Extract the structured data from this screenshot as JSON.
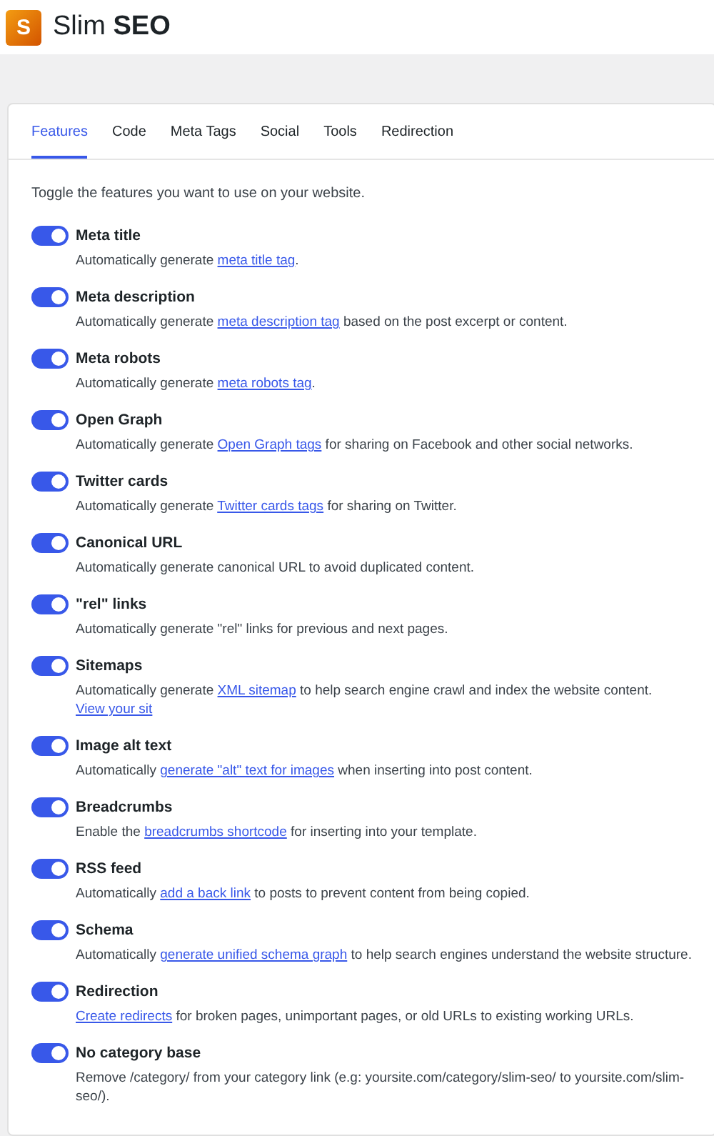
{
  "header": {
    "logo_letter": "S",
    "title": "Slim **SEO**"
  },
  "tabs": [
    {
      "label": "Features",
      "selected": true
    },
    {
      "label": "Code",
      "selected": false
    },
    {
      "label": "Meta Tags",
      "selected": false
    },
    {
      "label": "Social",
      "selected": false
    },
    {
      "label": "Tools",
      "selected": false
    },
    {
      "label": "Redirection",
      "selected": false
    }
  ],
  "intro": "Toggle the features you want to use on your website.",
  "features": [
    {
      "title": "Meta title",
      "on": true,
      "description": [
        {
          "text": "Automatically generate ",
          "link": false
        },
        {
          "text": "meta title tag",
          "link": true
        },
        {
          "text": ".",
          "link": false
        }
      ]
    },
    {
      "title": "Meta description",
      "on": true,
      "description": [
        {
          "text": "Automatically generate ",
          "link": false
        },
        {
          "text": "meta description tag",
          "link": true
        },
        {
          "text": " based on the post excerpt or content.",
          "link": false
        }
      ]
    },
    {
      "title": "Meta robots",
      "on": true,
      "description": [
        {
          "text": "Automatically generate ",
          "link": false
        },
        {
          "text": "meta robots tag",
          "link": true
        },
        {
          "text": ".",
          "link": false
        }
      ]
    },
    {
      "title": "Open Graph",
      "on": true,
      "description": [
        {
          "text": "Automatically generate ",
          "link": false
        },
        {
          "text": "Open Graph tags",
          "link": true
        },
        {
          "text": " for sharing on Facebook and other social networks.",
          "link": false
        }
      ]
    },
    {
      "title": "Twitter cards",
      "on": true,
      "description": [
        {
          "text": "Automatically generate ",
          "link": false
        },
        {
          "text": "Twitter cards tags",
          "link": true
        },
        {
          "text": " for sharing on Twitter.",
          "link": false
        }
      ]
    },
    {
      "title": "Canonical URL",
      "on": true,
      "description": [
        {
          "text": "Automatically generate canonical URL to avoid duplicated content.",
          "link": false
        }
      ]
    },
    {
      "title": "\"rel\" links",
      "on": true,
      "description": [
        {
          "text": "Automatically generate \"rel\" links for previous and next pages.",
          "link": false
        }
      ]
    },
    {
      "title": "Sitemaps",
      "on": true,
      "description": [
        {
          "text": "Automatically generate ",
          "link": false
        },
        {
          "text": "XML sitemap",
          "link": true
        },
        {
          "text": " to help search engine crawl and index the website content. ",
          "link": false
        },
        {
          "text": "View your sit",
          "link": true
        }
      ]
    },
    {
      "title": "Image alt text",
      "on": true,
      "description": [
        {
          "text": "Automatically ",
          "link": false
        },
        {
          "text": "generate \"alt\" text for images",
          "link": true
        },
        {
          "text": " when inserting into post content.",
          "link": false
        }
      ]
    },
    {
      "title": "Breadcrumbs",
      "on": true,
      "description": [
        {
          "text": "Enable the ",
          "link": false
        },
        {
          "text": "breadcrumbs shortcode",
          "link": true
        },
        {
          "text": " for inserting into your template.",
          "link": false
        }
      ]
    },
    {
      "title": "RSS feed",
      "on": true,
      "description": [
        {
          "text": "Automatically ",
          "link": false
        },
        {
          "text": "add a back link",
          "link": true
        },
        {
          "text": " to posts to prevent content from being copied.",
          "link": false
        }
      ]
    },
    {
      "title": "Schema",
      "on": true,
      "description": [
        {
          "text": "Automatically ",
          "link": false
        },
        {
          "text": "generate unified schema graph",
          "link": true
        },
        {
          "text": " to help search engines understand the website structure.",
          "link": false
        }
      ]
    },
    {
      "title": "Redirection",
      "on": true,
      "description": [
        {
          "text": "Create redirects",
          "link": true
        },
        {
          "text": " for broken pages, unimportant pages, or old URLs to existing working URLs.",
          "link": false
        }
      ]
    },
    {
      "title": "No category base",
      "on": true,
      "description": [
        {
          "text": "Remove /category/ from your category link (e.g: yoursite.com/category/slim-seo/ to yoursite.com/slim-seo/).",
          "link": false
        }
      ]
    }
  ]
}
